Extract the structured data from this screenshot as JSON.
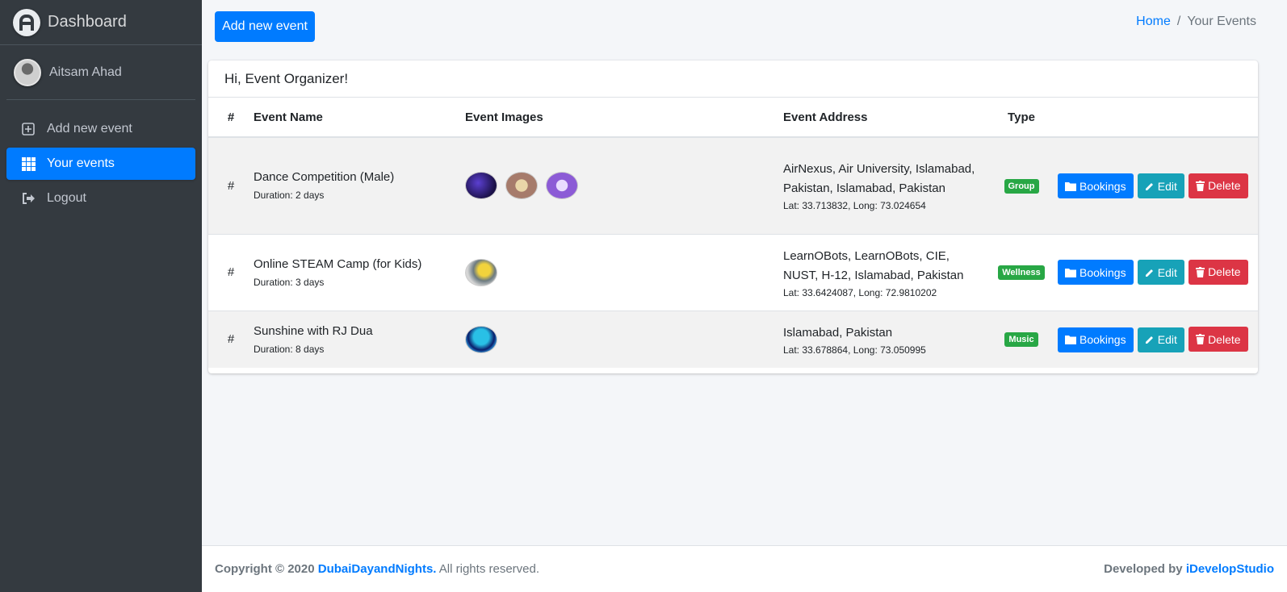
{
  "sidebar": {
    "brand": "Dashboard",
    "user": "Aitsam Ahad",
    "items": [
      {
        "label": "Add new event",
        "icon": "plus-square-icon"
      },
      {
        "label": "Your events",
        "icon": "grid-icon",
        "active": true
      },
      {
        "label": "Logout",
        "icon": "logout-icon"
      }
    ]
  },
  "header": {
    "add_button": "Add new event",
    "breadcrumb": {
      "home": "Home",
      "separator": "/",
      "current": "Your Events"
    }
  },
  "card": {
    "greeting": "Hi, Event Organizer!",
    "columns": [
      "#",
      "Event Name",
      "Event Images",
      "Event Address",
      "Type",
      ""
    ],
    "rows": [
      {
        "hash": "#",
        "name": "Dance Competition (Male)",
        "duration": "Duration: 2 days",
        "address": "AirNexus, Air University, Islamabad, Pakistan, Islamabad, Pakistan",
        "coords": "Lat: 33.713832, Long: 73.024654",
        "type": "Group",
        "bookings": "Bookings",
        "edit": "Edit",
        "delete": "Delete"
      },
      {
        "hash": "#",
        "name": "Online STEAM Camp (for Kids)",
        "duration": "Duration: 3 days",
        "address": "LearnOBots, LearnOBots, CIE, NUST, H-12, Islamabad, Pakistan",
        "coords": "Lat: 33.6424087, Long: 72.9810202",
        "type": "Wellness",
        "bookings": "Bookings",
        "edit": "Edit",
        "delete": "Delete"
      },
      {
        "hash": "#",
        "name": "Sunshine with RJ Dua",
        "duration": "Duration: 8 days",
        "address": "Islamabad, Pakistan",
        "coords": "Lat: 33.678864, Long: 73.050995",
        "type": "Music",
        "bookings": "Bookings",
        "edit": "Edit",
        "delete": "Delete"
      }
    ]
  },
  "footer": {
    "copyright": "Copyright © 2020",
    "site": "DubaiDayandNights.",
    "rights": "All rights reserved.",
    "developed": "Developed by",
    "developer": "iDevelopStudio"
  },
  "colors": {
    "primary": "#007bff",
    "sidebar": "#343a40",
    "success": "#28a745",
    "info": "#17a2b8",
    "danger": "#dc3545"
  }
}
